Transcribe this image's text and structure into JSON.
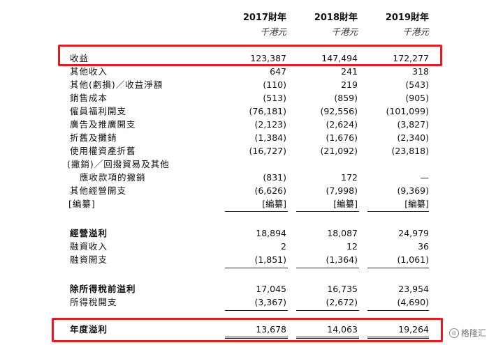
{
  "headers": {
    "years": [
      "2017財年",
      "2018財年",
      "2019財年"
    ],
    "units": [
      "千港元",
      "千港元",
      "千港元"
    ]
  },
  "rows": [
    {
      "label": "收益",
      "values": [
        "123,387",
        "147,494",
        "172,277"
      ]
    },
    {
      "label": "其他收入",
      "values": [
        "647",
        "241",
        "318"
      ]
    },
    {
      "label": "其他(虧損)／收益淨額",
      "values": [
        "(110)",
        "219",
        "(543)"
      ]
    },
    {
      "label": "銷售成本",
      "values": [
        "(513)",
        "(859)",
        "(905)"
      ]
    },
    {
      "label": "僱員福利開支",
      "values": [
        "(76,181)",
        "(92,556)",
        "(101,099)"
      ]
    },
    {
      "label": "廣告及推廣開支",
      "values": [
        "(2,123)",
        "(2,624)",
        "(3,827)"
      ]
    },
    {
      "label": "折舊及攤銷",
      "values": [
        "(1,384)",
        "(1,676)",
        "(2,340)"
      ]
    },
    {
      "label": "使用權資產折舊",
      "values": [
        "(16,727)",
        "(21,092)",
        "(23,818)"
      ]
    },
    {
      "label": "(撇銷)／回撥貿易及其他",
      "values": [
        "",
        "",
        ""
      ]
    },
    {
      "label": "應收款項的撇銷",
      "values": [
        "(831)",
        "172",
        "—"
      ]
    },
    {
      "label": "其他經營開支",
      "values": [
        "(6,626)",
        "(7,998)",
        "(9,369)"
      ]
    },
    {
      "label": "[編纂]",
      "values": [
        "[編纂]",
        "[編纂]",
        "[編纂]"
      ]
    },
    {
      "label": "經營溢利",
      "values": [
        "18,894",
        "18,087",
        "24,979"
      ]
    },
    {
      "label": "融資收入",
      "values": [
        "2",
        "12",
        "36"
      ]
    },
    {
      "label": "融資開支",
      "values": [
        "(1,851)",
        "(1,364)",
        "(1,061)"
      ]
    },
    {
      "label": "除所得稅前溢利",
      "values": [
        "17,045",
        "16,735",
        "23,954"
      ]
    },
    {
      "label": "所得稅開支",
      "values": [
        "(3,367)",
        "(2,672)",
        "(4,690)"
      ]
    },
    {
      "label": "年度溢利",
      "values": [
        "13,678",
        "14,063",
        "19,264"
      ]
    }
  ],
  "highlight_color": "#e31b23",
  "watermark": {
    "text": "格隆汇",
    "icon": "watermark-logo-icon"
  }
}
